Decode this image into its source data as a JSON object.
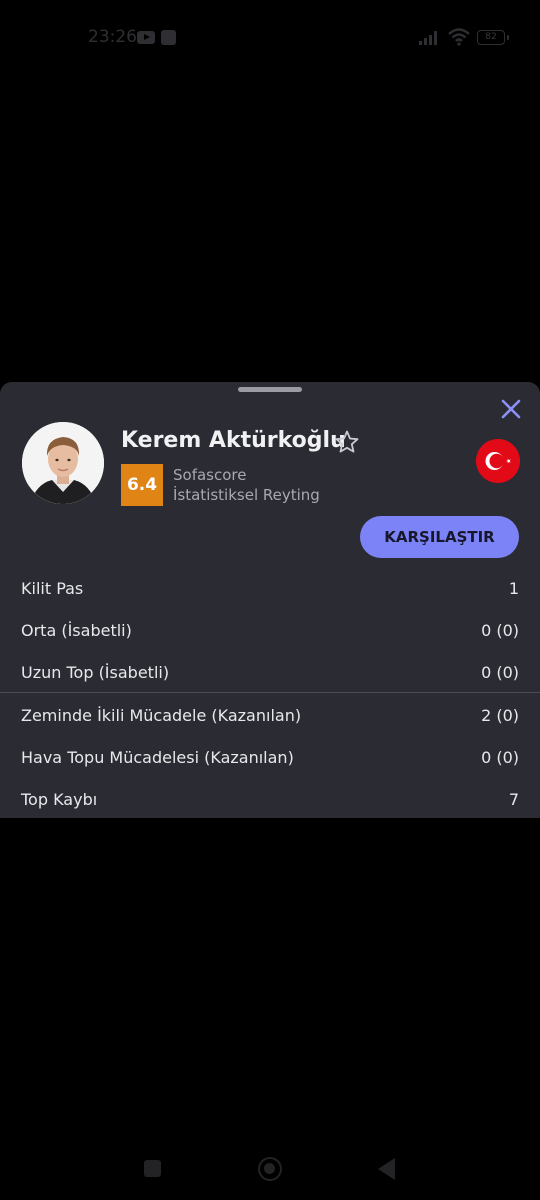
{
  "status_bar": {
    "time": "23:26",
    "battery_level": "82",
    "icons": [
      "youtube-icon",
      "app-icon",
      "signal-icon",
      "wifi-icon",
      "battery-icon"
    ]
  },
  "player": {
    "name": "Kerem Aktürkoğlu",
    "rating": "6.4",
    "rating_source": "Sofascore",
    "rating_label": "İstatistiksel Reyting",
    "rating_color": "#e08416",
    "flag_icon": "turkey-flag-icon",
    "favorite_icon": "star-outline-icon",
    "close_icon": "close-icon"
  },
  "actions": {
    "compare_label": "KARŞILAŞTIR",
    "compare_color": "#7c83f7"
  },
  "stats": [
    {
      "label": "Kilit Pas",
      "value": "1"
    },
    {
      "label": "Orta (İsabetli)",
      "value": "0 (0)"
    },
    {
      "label": "Uzun Top (İsabetli)",
      "value": "0 (0)"
    },
    {
      "label": "Zeminde İkili Mücadele (Kazanılan)",
      "value": "2 (0)"
    },
    {
      "label": "Hava Topu Mücadelesi (Kazanılan)",
      "value": "0 (0)"
    },
    {
      "label": "Top Kaybı",
      "value": "7"
    }
  ],
  "nav_bar": {
    "icons": [
      "recent-apps-icon",
      "home-icon",
      "back-icon"
    ]
  }
}
